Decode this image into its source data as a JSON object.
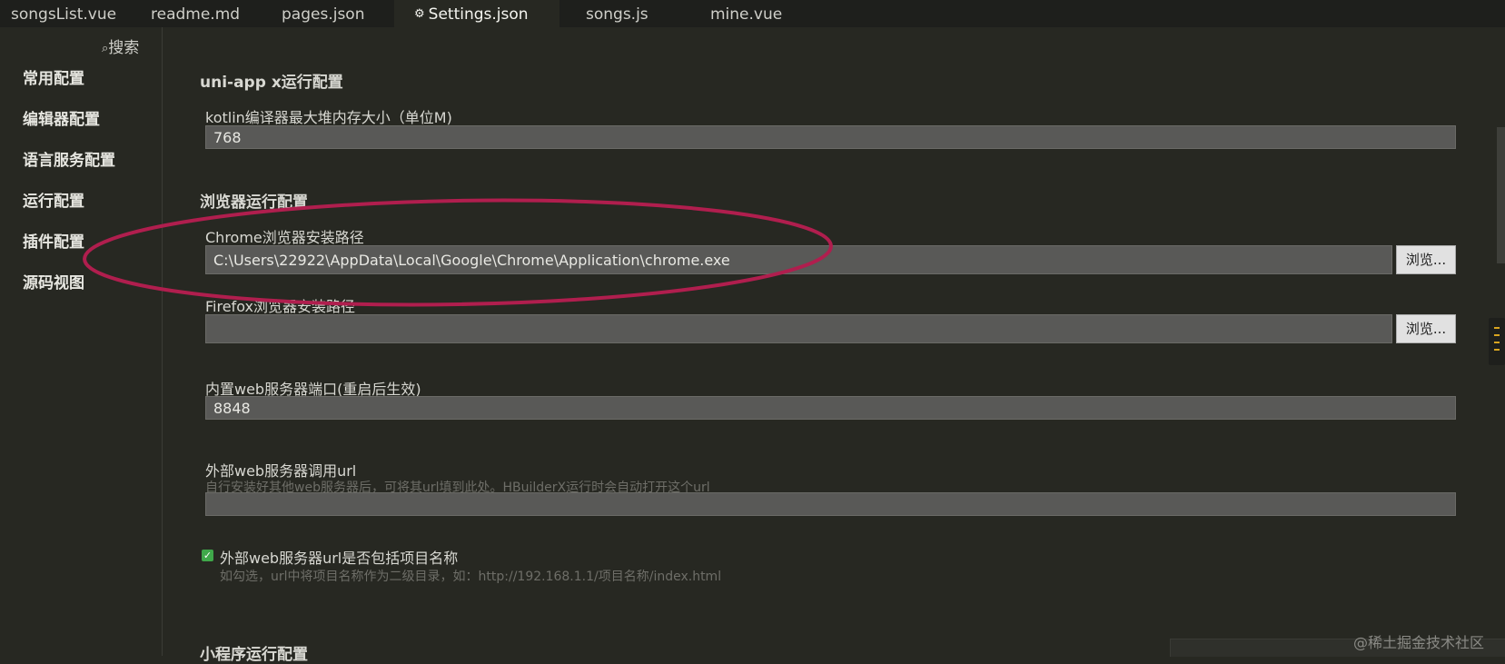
{
  "tabs": [
    {
      "label": "songsList.vue"
    },
    {
      "label": "readme.md"
    },
    {
      "label": "pages.json"
    },
    {
      "label": "Settings.json",
      "icon": "gear-icon"
    },
    {
      "label": "songs.js"
    },
    {
      "label": "mine.vue"
    }
  ],
  "sidebar": {
    "search_label": "搜索",
    "items": [
      {
        "label": "常用配置"
      },
      {
        "label": "编辑器配置"
      },
      {
        "label": "语言服务配置"
      },
      {
        "label": "运行配置"
      },
      {
        "label": "插件配置"
      },
      {
        "label": "源码视图"
      }
    ]
  },
  "uniappx": {
    "title": "uni-app x运行配置",
    "kotlin_label": "kotlin编译器最大堆内存大小（单位M)",
    "kotlin_value": "768"
  },
  "browser": {
    "title": "浏览器运行配置",
    "chrome_label": "Chrome浏览器安装路径",
    "chrome_value": "C:\\Users\\22922\\AppData\\Local\\Google\\Chrome\\Application\\chrome.exe",
    "browse_label": "浏览...",
    "firefox_label": "Firefox浏览器安装路径",
    "firefox_value": "",
    "port_label": "内置web服务器端口(重启后生效)",
    "port_value": "8848",
    "external_label": "外部web服务器调用url",
    "external_hint": "自行安装好其他web服务器后，可将其url填到此处。HBuilderX运行时会自动打开这个url",
    "external_value": "",
    "include_label": "外部web服务器url是否包括项目名称",
    "include_hint": "如勾选，url中将项目名称作为二级目录，如：http://192.168.1.1/项目名称/index.html",
    "include_checked": true
  },
  "miniprogram": {
    "title": "小程序运行配置"
  },
  "watermark": "@稀土掘金技术社区",
  "colors": {
    "background": "#272822",
    "annotation": "#b01e4e",
    "checkbox": "#3fa84a"
  }
}
